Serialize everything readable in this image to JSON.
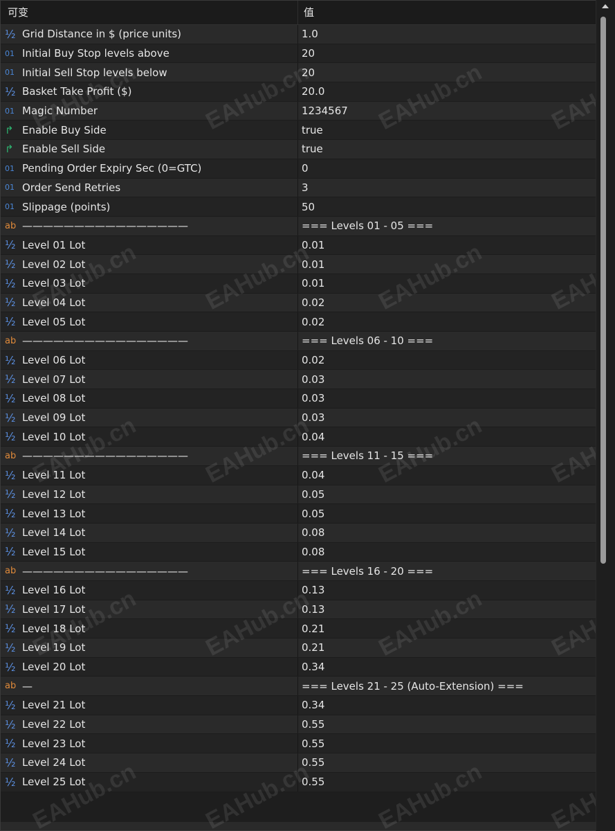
{
  "header": {
    "col_name": "可变",
    "col_value": "值"
  },
  "rows": [
    {
      "icon": "half",
      "name": "Grid Distance in $ (price units)",
      "value": "1.0"
    },
    {
      "icon": "int",
      "name": "Initial Buy Stop levels above",
      "value": "20"
    },
    {
      "icon": "int",
      "name": "Initial Sell Stop levels below",
      "value": "20"
    },
    {
      "icon": "half",
      "name": "Basket Take Profit ($)",
      "value": "20.0"
    },
    {
      "icon": "int",
      "name": "Magic Number",
      "value": "1234567"
    },
    {
      "icon": "bool",
      "name": "Enable Buy Side",
      "value": "true"
    },
    {
      "icon": "bool",
      "name": "Enable Sell Side",
      "value": "true"
    },
    {
      "icon": "int",
      "name": "Pending Order Expiry Sec (0=GTC)",
      "value": "0"
    },
    {
      "icon": "int",
      "name": "Order Send Retries",
      "value": "3"
    },
    {
      "icon": "int",
      "name": "Slippage (points)",
      "value": "50"
    },
    {
      "icon": "str",
      "name": "————————————————",
      "value": "=== Levels 01 - 05 ==="
    },
    {
      "icon": "half",
      "name": "Level 01 Lot",
      "value": "0.01"
    },
    {
      "icon": "half",
      "name": "Level 02 Lot",
      "value": "0.01"
    },
    {
      "icon": "half",
      "name": "Level 03 Lot",
      "value": "0.01"
    },
    {
      "icon": "half",
      "name": "Level 04 Lot",
      "value": "0.02"
    },
    {
      "icon": "half",
      "name": "Level 05 Lot",
      "value": "0.02"
    },
    {
      "icon": "str",
      "name": "————————————————",
      "value": "=== Levels 06 - 10 ==="
    },
    {
      "icon": "half",
      "name": "Level 06 Lot",
      "value": "0.02"
    },
    {
      "icon": "half",
      "name": "Level 07 Lot",
      "value": "0.03"
    },
    {
      "icon": "half",
      "name": "Level 08 Lot",
      "value": "0.03"
    },
    {
      "icon": "half",
      "name": "Level 09 Lot",
      "value": "0.03"
    },
    {
      "icon": "half",
      "name": "Level 10 Lot",
      "value": "0.04"
    },
    {
      "icon": "str",
      "name": "————————————————",
      "value": "=== Levels 11 - 15 ==="
    },
    {
      "icon": "half",
      "name": "Level 11 Lot",
      "value": "0.04"
    },
    {
      "icon": "half",
      "name": "Level 12 Lot",
      "value": "0.05"
    },
    {
      "icon": "half",
      "name": "Level 13 Lot",
      "value": "0.05"
    },
    {
      "icon": "half",
      "name": "Level 14 Lot",
      "value": "0.08"
    },
    {
      "icon": "half",
      "name": "Level 15 Lot",
      "value": "0.08"
    },
    {
      "icon": "str",
      "name": "————————————————",
      "value": "=== Levels 16 - 20 ==="
    },
    {
      "icon": "half",
      "name": "Level 16 Lot",
      "value": "0.13"
    },
    {
      "icon": "half",
      "name": "Level 17 Lot",
      "value": "0.13"
    },
    {
      "icon": "half",
      "name": "Level 18 Lot",
      "value": "0.21"
    },
    {
      "icon": "half",
      "name": "Level 19 Lot",
      "value": "0.21"
    },
    {
      "icon": "half",
      "name": "Level 20 Lot",
      "value": "0.34"
    },
    {
      "icon": "str",
      "name": "—",
      "value": "=== Levels 21 - 25 (Auto-Extension) ==="
    },
    {
      "icon": "half",
      "name": "Level 21 Lot",
      "value": "0.34"
    },
    {
      "icon": "half",
      "name": "Level 22 Lot",
      "value": "0.55"
    },
    {
      "icon": "half",
      "name": "Level 23 Lot",
      "value": "0.55"
    },
    {
      "icon": "half",
      "name": "Level 24 Lot",
      "value": "0.55"
    },
    {
      "icon": "half",
      "name": "Level 25 Lot",
      "value": "0.55"
    }
  ],
  "icon_glyphs": {
    "half": "½",
    "int": "01",
    "bool": "↱",
    "str": "ab"
  },
  "icon_names": {
    "half": "double-type-icon",
    "int": "integer-type-icon",
    "bool": "bool-type-icon",
    "str": "string-type-icon"
  },
  "watermark": "EAHub.cn"
}
